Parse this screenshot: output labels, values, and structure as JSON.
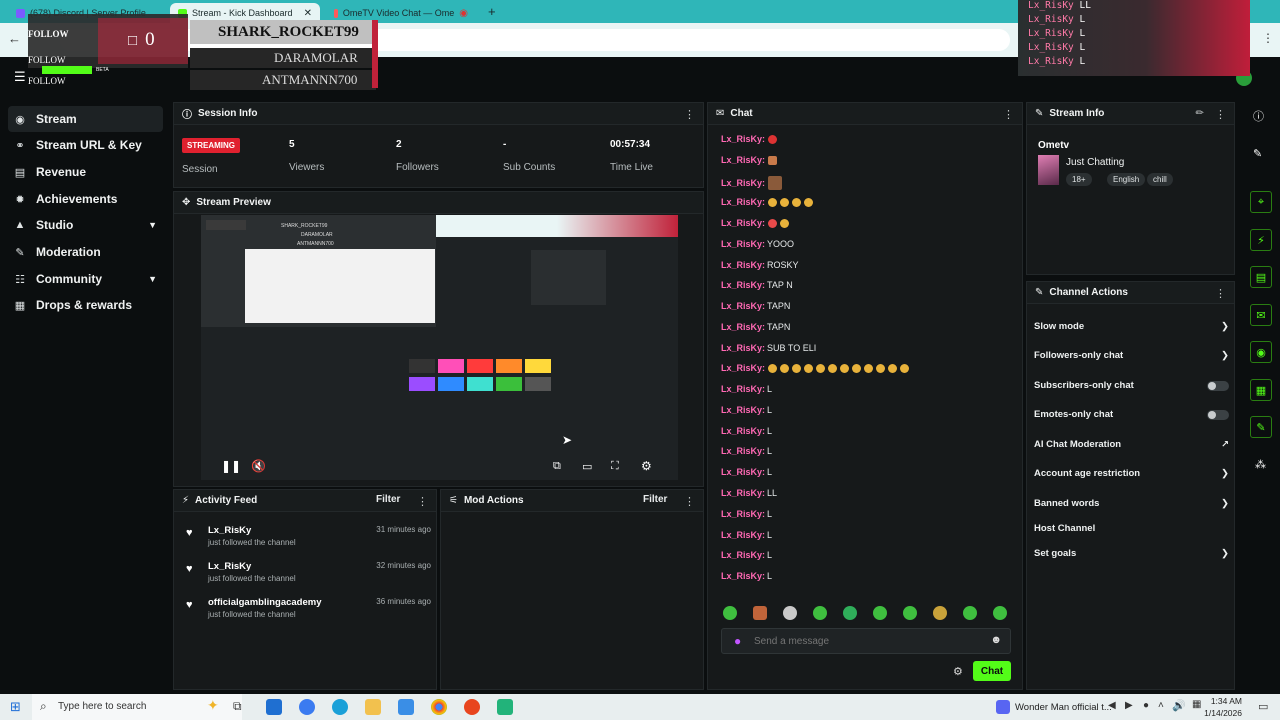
{
  "browser": {
    "tabs": [
      {
        "label": "(678) Discord | Server Profile",
        "color": "#7a5cff"
      },
      {
        "label": "Stream - Kick Dashboard",
        "color": "#53fc18"
      },
      {
        "label": "OmeTV Video Chat — Ome",
        "color": "#ff5a5a"
      }
    ],
    "new_tab": "+"
  },
  "overlay": {
    "follow_label": "FOLLOW",
    "follow_count": "0",
    "recent": [
      "SHARK_ROCKET99",
      "DARAMOLAR",
      "ANTMANNN700"
    ],
    "mini_follow": [
      "FOLLOW",
      "FOLLOW"
    ],
    "beta": "BETA"
  },
  "chat_overlay": {
    "lines": [
      {
        "user": "Lx_RisKy",
        "msg": "LL"
      },
      {
        "user": "Lx_RisKy",
        "msg": "L"
      },
      {
        "user": "Lx_RisKy",
        "msg": "L"
      },
      {
        "user": "Lx_RisKy",
        "msg": "L"
      },
      {
        "user": "Lx_RisKy",
        "msg": "L"
      }
    ]
  },
  "nav": {
    "items": [
      {
        "label": "Stream",
        "icon": "broadcast-icon",
        "active": true
      },
      {
        "label": "Stream URL & Key",
        "icon": "link-icon"
      },
      {
        "label": "Revenue",
        "icon": "chart-icon"
      },
      {
        "label": "Achievements",
        "icon": "trophy-icon"
      },
      {
        "label": "Studio",
        "icon": "studio-icon",
        "expand": true
      },
      {
        "label": "Moderation",
        "icon": "wrench-icon"
      },
      {
        "label": "Community",
        "icon": "people-icon",
        "expand": true
      },
      {
        "label": "Drops & rewards",
        "icon": "gift-icon"
      }
    ]
  },
  "session": {
    "title": "Session Info",
    "status_badge": "STREAMING",
    "status_label": "Session",
    "viewers_value": "5",
    "viewers_label": "Viewers",
    "followers_value": "2",
    "followers_label": "Followers",
    "subs_value": "-",
    "subs_label": "Sub Counts",
    "time_value": "00:57:34",
    "time_label": "Time Live"
  },
  "preview": {
    "title": "Stream Preview",
    "mini_overlay_names": [
      "SHARK_ROCKET99",
      "DARAMOLAR",
      "ANTMANNN700"
    ],
    "swatches": [
      "#333333",
      "#ff4fb8",
      "#ff3b3b",
      "#ff8a2a",
      "#ffd93b",
      "#9b4dff",
      "#2f8bff",
      "#3fe0d0",
      "#3bbf3b",
      "#555555"
    ]
  },
  "activity": {
    "title": "Activity Feed",
    "filter": "Filter",
    "items": [
      {
        "name": "Lx_RisKy",
        "sub": "just followed the channel",
        "time": "31 minutes ago"
      },
      {
        "name": "Lx_RisKy",
        "sub": "just followed the channel",
        "time": "32 minutes ago"
      },
      {
        "name": "officialgamblingacademy",
        "sub": "just followed the channel",
        "time": "36 minutes ago"
      }
    ]
  },
  "mod": {
    "title": "Mod Actions",
    "filter": "Filter"
  },
  "chat": {
    "title": "Chat",
    "messages": [
      {
        "user": "Lx_RisKy:",
        "msg": ""
      },
      {
        "user": "Lx_RisKy:",
        "msg": ""
      },
      {
        "user": "Lx_RisKy:",
        "msg": ""
      },
      {
        "user": "Lx_RisKy:",
        "msg": ""
      },
      {
        "user": "Lx_RisKy:",
        "msg": ""
      },
      {
        "user": "Lx_RisKy:",
        "msg": "YOOO"
      },
      {
        "user": "Lx_RisKy:",
        "msg": "ROSKY"
      },
      {
        "user": "Lx_RisKy:",
        "msg": "TAP N"
      },
      {
        "user": "Lx_RisKy:",
        "msg": "TAPN"
      },
      {
        "user": "Lx_RisKy:",
        "msg": "TAPN"
      },
      {
        "user": "Lx_RisKy:",
        "msg": "SUB TO ELI"
      },
      {
        "user": "Lx_RisKy:",
        "msg": ""
      },
      {
        "user": "Lx_RisKy:",
        "msg": "L"
      },
      {
        "user": "Lx_RisKy:",
        "msg": "L"
      },
      {
        "user": "Lx_RisKy:",
        "msg": "L"
      },
      {
        "user": "Lx_RisKy:",
        "msg": "L"
      },
      {
        "user": "Lx_RisKy:",
        "msg": "L"
      },
      {
        "user": "Lx_RisKy:",
        "msg": "LL"
      },
      {
        "user": "Lx_RisKy:",
        "msg": "L"
      },
      {
        "user": "Lx_RisKy:",
        "msg": "L"
      },
      {
        "user": "Lx_RisKy:",
        "msg": "L"
      },
      {
        "user": "Lx_RisKy:",
        "msg": "L"
      }
    ],
    "placeholder": "Send a message",
    "send_label": "Chat"
  },
  "stream_info": {
    "title": "Stream Info",
    "channel_name": "Ometv",
    "category": "Just Chatting",
    "tags": [
      "18+",
      "English",
      "chill"
    ]
  },
  "channel_actions": {
    "title": "Channel Actions",
    "items": [
      {
        "label": "Slow mode",
        "kind": "chevron"
      },
      {
        "label": "Followers-only chat",
        "kind": "chevron"
      },
      {
        "label": "Subscribers-only chat",
        "kind": "toggle"
      },
      {
        "label": "Emotes-only chat",
        "kind": "toggle"
      },
      {
        "label": "AI Chat Moderation",
        "kind": "external"
      },
      {
        "label": "Account age restriction",
        "kind": "chevron"
      },
      {
        "label": "Banned words",
        "kind": "chevron"
      },
      {
        "label": "Host Channel",
        "kind": "none"
      },
      {
        "label": "Set goals",
        "kind": "chevron"
      }
    ]
  },
  "taskbar": {
    "search_placeholder": "Type here to search",
    "media": "Wonder Man official t...",
    "time": "1:34 AM",
    "date": "1/14/2026"
  },
  "colors": {
    "accent": "#53fc18",
    "badge": "#e0212f",
    "username": "#ff69b4",
    "bg": "#0b0e0f",
    "panel": "#16191a"
  }
}
